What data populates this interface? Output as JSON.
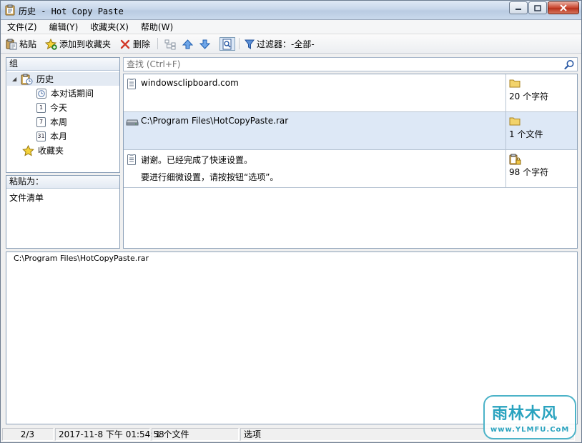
{
  "window": {
    "title": "历史 - Hot Copy Paste"
  },
  "menu": [
    "文件(Z)",
    "编辑(Y)",
    "收藏夹(X)",
    "帮助(W)"
  ],
  "toolbar": {
    "paste": "粘贴",
    "add_favorite": "添加到收藏夹",
    "delete": "删除",
    "filter_label": "过滤器：-全部-"
  },
  "groups": {
    "header": "组",
    "history": "历史",
    "session": "本对话期间",
    "today": "今天",
    "week": "本周",
    "month": "本月",
    "favorites": "收藏夹",
    "today_num": "1",
    "week_num": "7",
    "month_num": "31"
  },
  "paste_as": {
    "header": "粘贴为：",
    "item": "文件清单"
  },
  "search": {
    "placeholder": "查找 (Ctrl+F)"
  },
  "history_items": [
    {
      "line1": "windowsclipboard.com",
      "line2": "",
      "meta": "20 个字符"
    },
    {
      "line1": "C:\\Program Files\\HotCopyPaste.rar",
      "line2": "",
      "meta": "1 个文件"
    },
    {
      "line1": "谢谢。已经完成了快速设置。",
      "line2": "要进行细微设置，请按按钮“选项”。",
      "meta": "98 个字符"
    }
  ],
  "preview": {
    "text": "C:\\Program Files\\HotCopyPaste.rar"
  },
  "status": {
    "position": "2/3",
    "datetime": "2017-11-8 下午 01:54:58",
    "info": "1 个文件",
    "options": "选项"
  },
  "watermark": {
    "brand": "雨林木风",
    "url": "www.YLMFU.CoM"
  },
  "colors": {
    "selection": "#dde8f6",
    "border": "#8a9fb7",
    "accent": "#2b5aa5"
  }
}
